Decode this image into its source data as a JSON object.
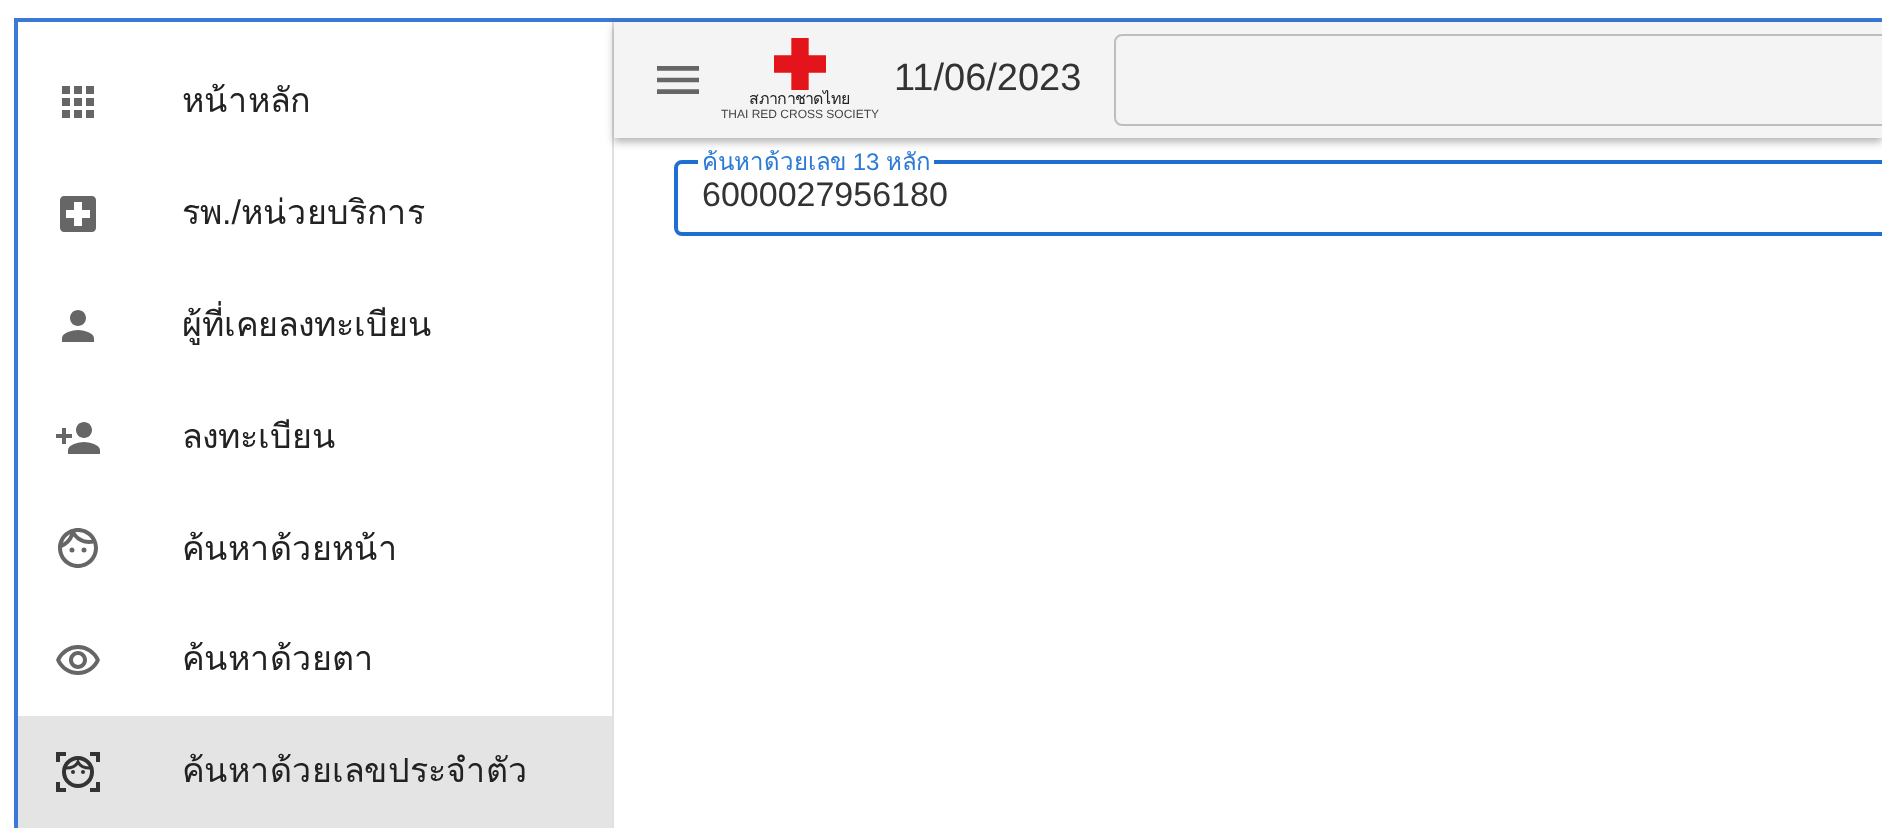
{
  "sidebar": {
    "items": [
      {
        "kind": "apps",
        "label": "หน้าหลัก",
        "selected": false
      },
      {
        "kind": "hospital",
        "label": "รพ./หน่วยบริการ",
        "selected": false
      },
      {
        "kind": "person",
        "label": "ผู้ที่เคยลงทะเบียน",
        "selected": false
      },
      {
        "kind": "person-add",
        "label": "ลงทะเบียน",
        "selected": false
      },
      {
        "kind": "face",
        "label": "ค้นหาด้วยหน้า",
        "selected": false
      },
      {
        "kind": "eye",
        "label": "ค้นหาด้วยตา",
        "selected": false
      },
      {
        "kind": "face-scan",
        "label": "ค้นหาด้วยเลขประจำตัว",
        "selected": true
      }
    ]
  },
  "header": {
    "logo": {
      "name": "สภากาชาดไทย",
      "subtitle": "THAI RED CROSS SOCIETY"
    },
    "date": "11/06/2023"
  },
  "search": {
    "label": "ค้นหาด้วยเลข 13 หลัก",
    "value": "6000027956180"
  }
}
